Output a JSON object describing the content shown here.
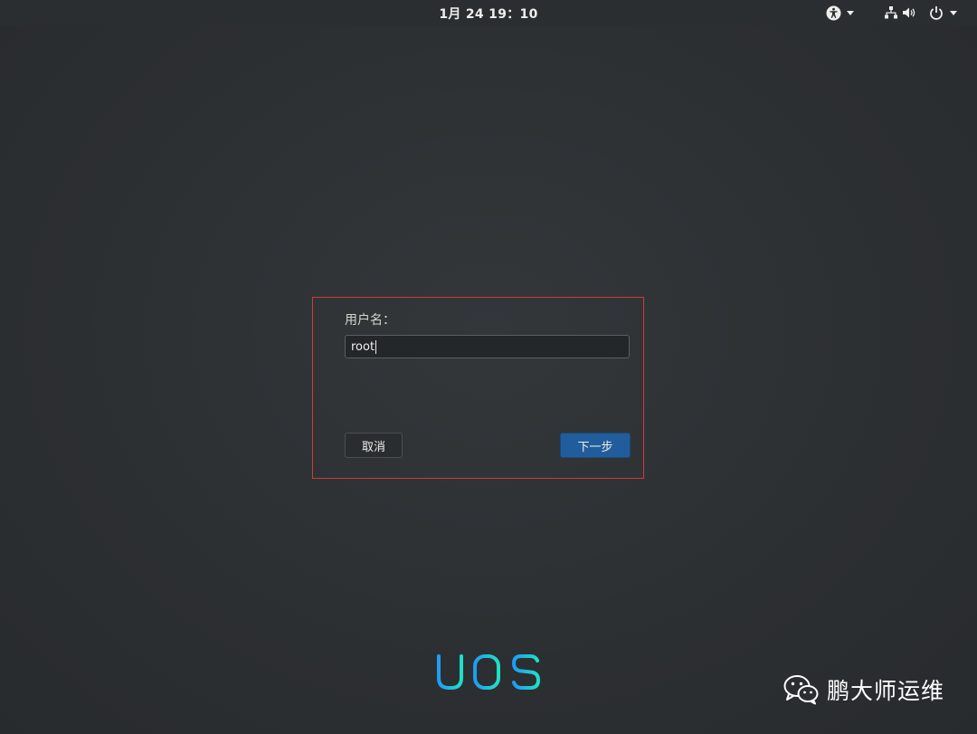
{
  "top_bar": {
    "clock": "1月 24  19：10",
    "icons": [
      "accessibility-icon",
      "network-icon",
      "volume-icon",
      "power-icon"
    ]
  },
  "login": {
    "username_label": "用户名：",
    "username_value": "root",
    "cancel_label": "取消",
    "next_label": "下一步",
    "highlight_color": "#d03a3a",
    "accent_color": "#215d9c"
  },
  "branding": {
    "logo_text": "UOS",
    "logo_gradient": [
      "#1e9df2",
      "#1ee0c8"
    ]
  },
  "watermark": {
    "icon": "wechat-icon",
    "text": "鹏大师运维"
  }
}
